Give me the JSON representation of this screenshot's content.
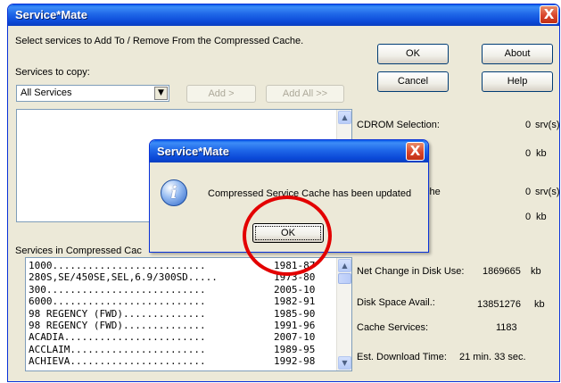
{
  "main": {
    "title": "Service*Mate",
    "close": "X",
    "instructions": "Select services to Add To / Remove From the Compressed Cache.",
    "services_to_copy_label": "Services to copy:",
    "combo_value": "All Services",
    "add_label": "Add >",
    "add_all_label": "Add All >>",
    "cache_label": "Services in Compressed Cac",
    "buttons": {
      "ok": "OK",
      "about": "About",
      "cancel": "Cancel",
      "help": "Help"
    },
    "stats": {
      "cdrom_label": "CDROM Selection:",
      "cdrom_value": "0",
      "cdrom_unit": "srv(s)",
      "kb1_value": "0",
      "kb1_unit": "kb",
      "cache_label_frag": "che",
      "cache_srv_value": "0",
      "cache_srv_unit": "srv(s)",
      "kb2_value": "0",
      "kb2_unit": "kb",
      "net_change_label": "Net Change in Disk Use:",
      "net_change_value": "1869665",
      "net_change_unit": "kb",
      "disk_space_label": "Disk Space Avail.:",
      "disk_space_value": "13851276",
      "disk_space_unit": "kb",
      "cache_services_label": "Cache Services:",
      "cache_services_value": "1183",
      "download_label": "Est. Download Time:",
      "download_value": "21 min. 33 sec."
    },
    "cache_list": [
      {
        "name": "1000..........................",
        "years": "1981-87"
      },
      {
        "name": "280S,SE/450SE,SEL,6.9/300SD.....",
        "years": "1973-80"
      },
      {
        "name": "300...........................",
        "years": "2005-10"
      },
      {
        "name": "6000..........................",
        "years": "1982-91"
      },
      {
        "name": "98 REGENCY (FWD)..............",
        "years": "1985-90"
      },
      {
        "name": "98 REGENCY (FWD)..............",
        "years": "1991-96"
      },
      {
        "name": "ACADIA........................",
        "years": "2007-10"
      },
      {
        "name": "ACCLAIM.......................",
        "years": "1989-95"
      },
      {
        "name": "ACHIEVA.......................",
        "years": "1992-98"
      }
    ]
  },
  "dialog": {
    "title": "Service*Mate",
    "close": "X",
    "message": "Compressed Service Cache has been updated",
    "ok": "OK",
    "icon": "info-icon"
  },
  "colors": {
    "title_blue": "#0b49d8",
    "window_bg": "#ece9d8",
    "close_red": "#d9442b",
    "annotation_red": "#e30000"
  }
}
